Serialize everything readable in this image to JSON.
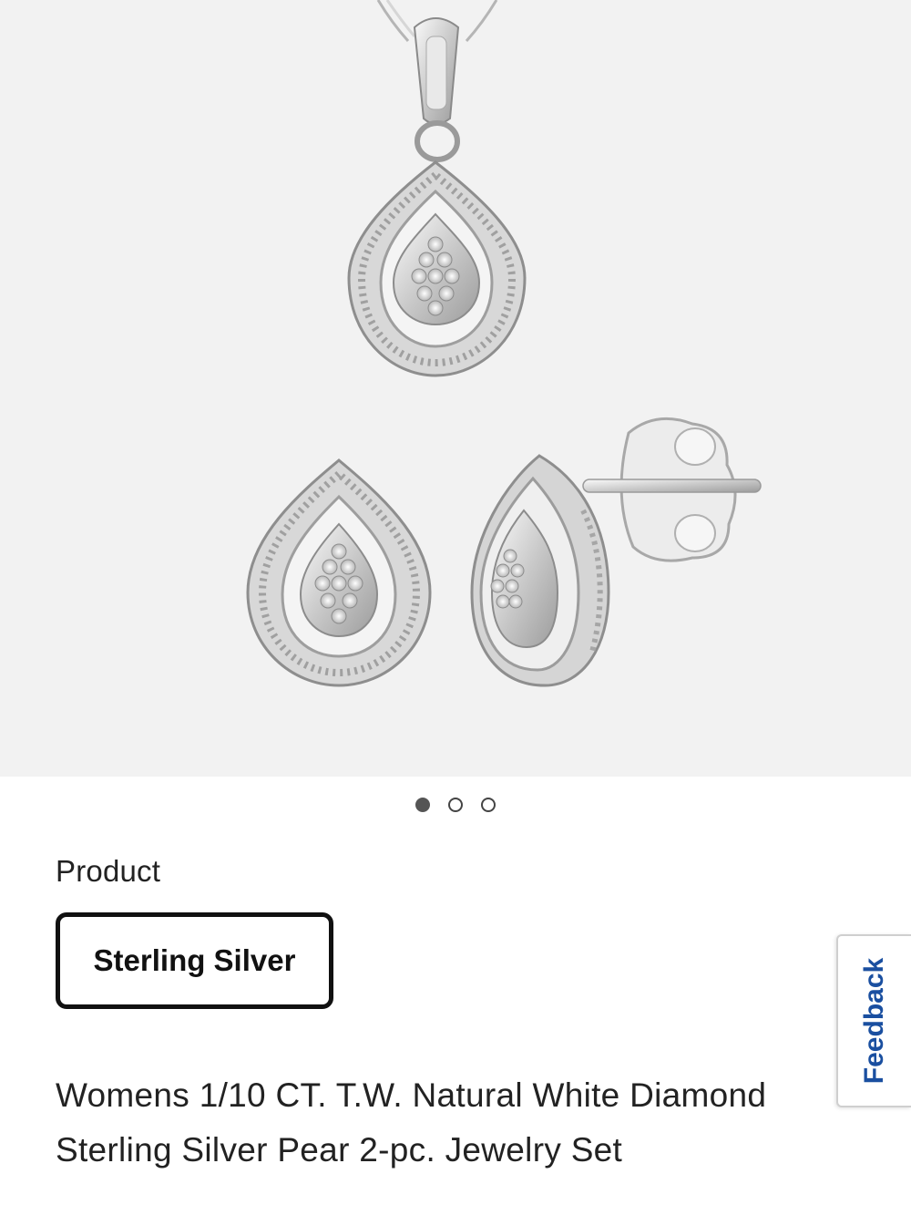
{
  "image": {
    "alt": "Pear-shaped diamond pendant necklace and matching stud earrings",
    "background_color": "#f2f2f2"
  },
  "carousel": {
    "total": 3,
    "active_index": 0
  },
  "product_option": {
    "label": "Product",
    "selected": "Sterling Silver"
  },
  "product": {
    "title": "Womens 1/10 CT. T.W. Natural White Diamond Sterling Silver Pear 2-pc. Jewelry Set"
  },
  "feedback": {
    "label": "Feedback",
    "color": "#1a4fa0"
  }
}
